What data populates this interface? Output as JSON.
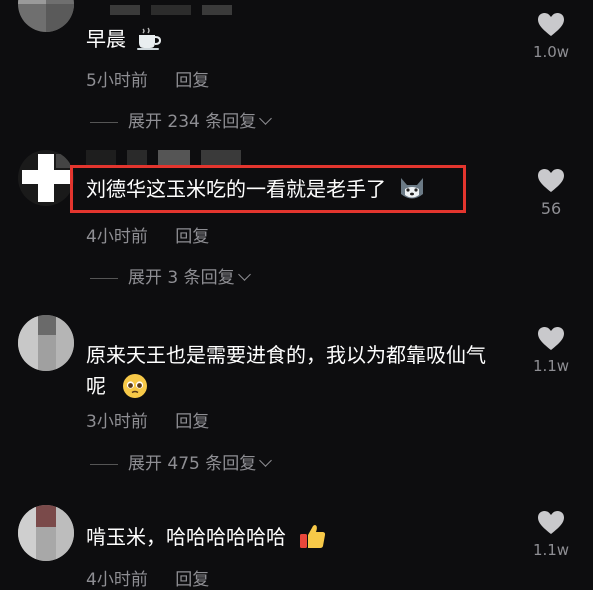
{
  "comments": [
    {
      "text": "早晨",
      "time": "5小时前",
      "reply_label": "回复",
      "expand_label": "展开 234 条回复",
      "likes": "1.0w",
      "emoji": "coffee-cup"
    },
    {
      "text": "刘德华这玉米吃的一看就是老手了",
      "time": "4小时前",
      "reply_label": "回复",
      "expand_label": "展开 3 条回复",
      "likes": "56",
      "emoji": "husky-face"
    },
    {
      "text_line1": "原来天王也是需要进食的，我以为都靠吸仙气",
      "text_line2": "呢",
      "time": "3小时前",
      "reply_label": "回复",
      "expand_label": "展开 475 条回复",
      "likes": "1.1w",
      "emoji": "pleading-face"
    },
    {
      "text": "啃玉米，哈哈哈哈哈哈",
      "time": "4小时前",
      "reply_label": "回复",
      "likes": "1.1w",
      "emoji": "thumbs-up"
    }
  ],
  "colors": {
    "background": "#0d0d0f",
    "text": "#ffffff",
    "meta": "#8e8e93",
    "highlight_border": "#e3352e"
  }
}
